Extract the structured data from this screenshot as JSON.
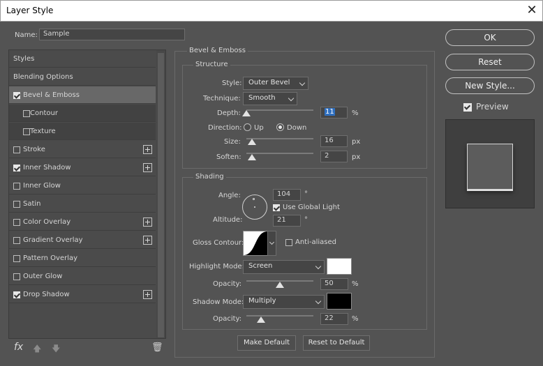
{
  "window": {
    "title": "Layer Style",
    "close_glyph": "✕"
  },
  "name_field": {
    "label": "Name:",
    "value": "Sample"
  },
  "styles_list": [
    {
      "label": "Styles",
      "checkbox": false,
      "checked": false,
      "plus": false,
      "sub": false,
      "selected": false
    },
    {
      "label": "Blending Options",
      "checkbox": false,
      "checked": false,
      "plus": false,
      "sub": false,
      "selected": false
    },
    {
      "label": "Bevel & Emboss",
      "checkbox": true,
      "checked": true,
      "plus": false,
      "sub": false,
      "selected": true
    },
    {
      "label": "Contour",
      "checkbox": true,
      "checked": false,
      "plus": false,
      "sub": true,
      "selected": false
    },
    {
      "label": "Texture",
      "checkbox": true,
      "checked": false,
      "plus": false,
      "sub": true,
      "selected": false
    },
    {
      "label": "Stroke",
      "checkbox": true,
      "checked": false,
      "plus": true,
      "sub": false,
      "selected": false
    },
    {
      "label": "Inner Shadow",
      "checkbox": true,
      "checked": true,
      "plus": true,
      "sub": false,
      "selected": false
    },
    {
      "label": "Inner Glow",
      "checkbox": true,
      "checked": false,
      "plus": false,
      "sub": false,
      "selected": false
    },
    {
      "label": "Satin",
      "checkbox": true,
      "checked": false,
      "plus": false,
      "sub": false,
      "selected": false
    },
    {
      "label": "Color Overlay",
      "checkbox": true,
      "checked": false,
      "plus": true,
      "sub": false,
      "selected": false
    },
    {
      "label": "Gradient Overlay",
      "checkbox": true,
      "checked": false,
      "plus": true,
      "sub": false,
      "selected": false
    },
    {
      "label": "Pattern Overlay",
      "checkbox": true,
      "checked": false,
      "plus": false,
      "sub": false,
      "selected": false
    },
    {
      "label": "Outer Glow",
      "checkbox": true,
      "checked": false,
      "plus": false,
      "sub": false,
      "selected": false
    },
    {
      "label": "Drop Shadow",
      "checkbox": true,
      "checked": true,
      "plus": true,
      "sub": false,
      "selected": false
    }
  ],
  "bottom_icons": {
    "fx": "fx",
    "up": "🡅",
    "down": "🡇",
    "trash": "🗑"
  },
  "panel": {
    "title": "Bevel & Emboss",
    "structure": {
      "legend": "Structure",
      "style_label": "Style:",
      "style_value": "Outer Bevel",
      "technique_label": "Technique:",
      "technique_value": "Smooth",
      "depth_label": "Depth:",
      "depth_value": "11",
      "depth_unit": "%",
      "depth_level": 0.0,
      "direction_label": "Direction:",
      "direction_up": "Up",
      "direction_down": "Down",
      "direction_selected": "Down",
      "size_label": "Size:",
      "size_value": "16",
      "size_unit": "px",
      "size_level": 0.08,
      "soften_label": "Soften:",
      "soften_value": "2",
      "soften_unit": "px",
      "soften_level": 0.08
    },
    "shading": {
      "legend": "Shading",
      "angle_label": "Angle:",
      "angle_value": "104",
      "angle_unit": "°",
      "global_light_label": "Use Global Light",
      "global_light_checked": true,
      "altitude_label": "Altitude:",
      "altitude_value": "21",
      "altitude_unit": "°",
      "gloss_label": "Gloss Contour:",
      "anti_aliased_label": "Anti-aliased",
      "anti_aliased_checked": false,
      "highlight_label": "Highlight Mode:",
      "highlight_value": "Screen",
      "highlight_color": "#ffffff",
      "highlight_opacity_label": "Opacity:",
      "highlight_opacity_value": "50",
      "highlight_opacity_unit": "%",
      "highlight_opacity_level": 0.5,
      "shadow_label": "Shadow Mode:",
      "shadow_value": "Multiply",
      "shadow_color": "#000000",
      "shadow_opacity_label": "Opacity:",
      "shadow_opacity_value": "22",
      "shadow_opacity_unit": "%",
      "shadow_opacity_level": 0.22
    },
    "make_default": "Make Default",
    "reset_default": "Reset to Default"
  },
  "right_buttons": {
    "ok": "OK",
    "reset": "Reset",
    "new_style": "New Style...",
    "preview_label": "Preview",
    "preview_checked": true
  }
}
